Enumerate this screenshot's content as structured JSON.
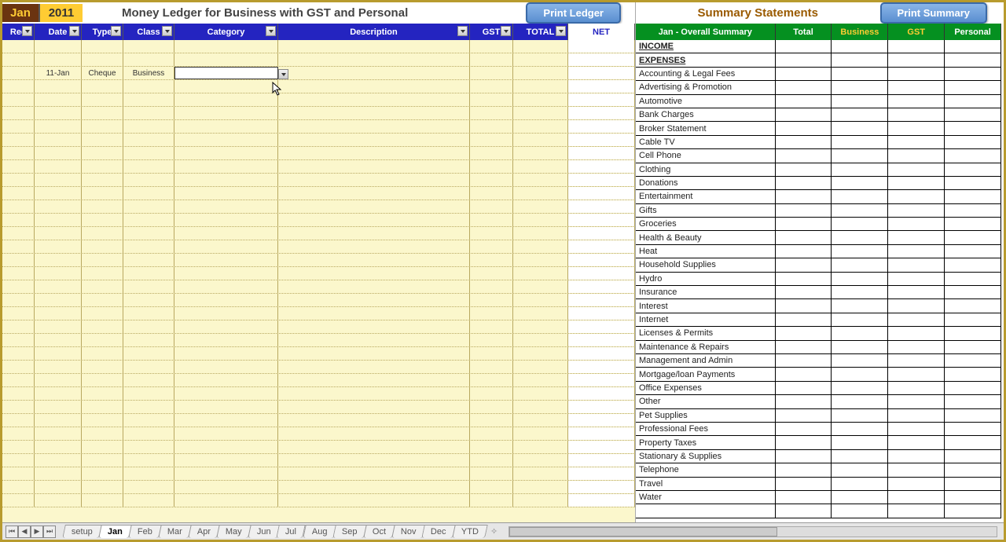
{
  "header": {
    "month": "Jan",
    "year": "2011",
    "title": "Money Ledger for Business with GST and Personal",
    "print_ledger": "Print Ledger",
    "summary_title": "Summary Statements",
    "print_summary": "Print Summary"
  },
  "ledger_columns": {
    "rec": "Rec",
    "date": "Date",
    "type": "Type",
    "class": "Class",
    "category": "Category",
    "description": "Description",
    "gst": "GST",
    "total": "TOTAL",
    "net": "NET"
  },
  "ledger_row": {
    "date": "11-Jan",
    "type": "Cheque",
    "class": "Business",
    "category": "",
    "description": "",
    "gst": "",
    "total": "",
    "net": ""
  },
  "summary_columns": {
    "main": "Jan - Overall Summary",
    "total": "Total",
    "business": "Business",
    "gst": "GST",
    "personal": "Personal"
  },
  "summary_sections": {
    "income": "INCOME",
    "expenses": "EXPENSES"
  },
  "expense_categories": [
    "Accounting & Legal Fees",
    "Advertising & Promotion",
    "Automotive",
    "Bank Charges",
    "Broker Statement",
    "Cable TV",
    "Cell Phone",
    "Clothing",
    "Donations",
    "Entertainment",
    "Gifts",
    "Groceries",
    "Health & Beauty",
    "Heat",
    "Household Supplies",
    "Hydro",
    "Insurance",
    "Interest",
    "Internet",
    "Licenses & Permits",
    "Maintenance & Repairs",
    "Management and Admin",
    "Mortgage/loan Payments",
    "Office Expenses",
    "Other",
    "Pet Supplies",
    "Professional Fees",
    "Property Taxes",
    "Stationary & Supplies",
    "Telephone",
    "Travel",
    "Water"
  ],
  "sheet_tabs": [
    "setup",
    "Jan",
    "Feb",
    "Mar",
    "Apr",
    "May",
    "Jun",
    "Jul",
    "Aug",
    "Sep",
    "Oct",
    "Nov",
    "Dec",
    "YTD"
  ],
  "active_tab": "Jan"
}
